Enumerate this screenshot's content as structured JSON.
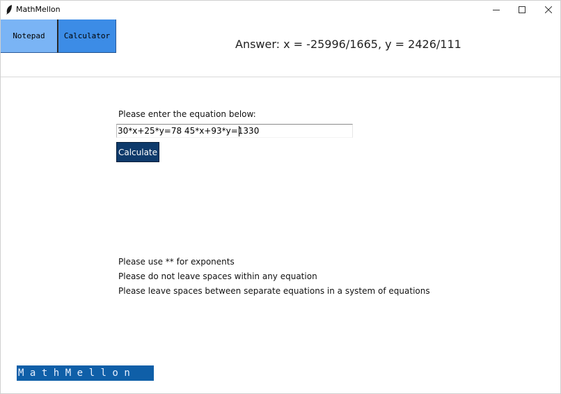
{
  "window": {
    "title": "MathMellon",
    "icon": "feather-icon"
  },
  "toolbar": {
    "notepad_label": "Notepad",
    "calculator_label": "Calculator",
    "answer_text": "Answer: x = -25996/1665, y = 2426/111"
  },
  "main": {
    "prompt_label": "Please enter the equation below:",
    "equation_value": "30*x+25*y=78 45*x+93*y=1330",
    "calculate_label": "Calculate",
    "tips": [
      "Please use ** for exponents",
      "Please do not leave spaces within any equation",
      "Please leave spaces between separate equations in a system of equations"
    ]
  },
  "footer": {
    "brand_text": "MathMellon"
  },
  "colors": {
    "notepad_bg": "#7ab4f5",
    "calculator_bg": "#3c8ce6",
    "calculate_button_bg": "#0e3a6b",
    "brand_bg": "#0f5fa8"
  }
}
